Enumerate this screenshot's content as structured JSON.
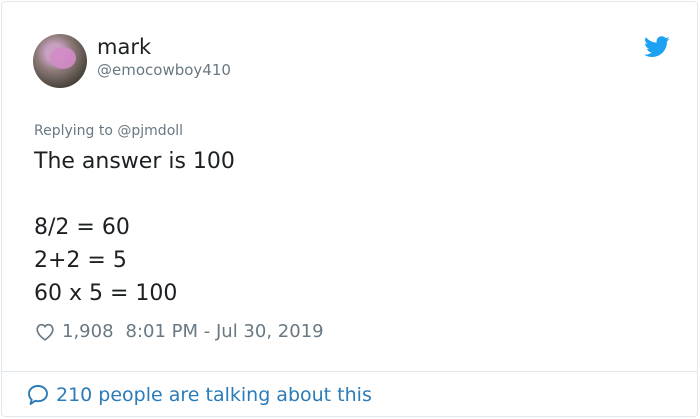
{
  "user": {
    "name": "mark",
    "handle": "@emocowboy410"
  },
  "reply": {
    "prefix": "Replying to ",
    "mention": "@pjmdoll"
  },
  "tweet": {
    "lines": [
      "The answer is 100",
      "",
      "8/2 = 60",
      "2+2 = 5",
      "60 x 5 = 100"
    ]
  },
  "meta": {
    "likes": "1,908",
    "timestamp": "8:01 PM - Jul 30, 2019"
  },
  "footer": {
    "talking": "210 people are talking about this"
  },
  "icons": {
    "bird": "twitter-bird-icon",
    "heart": "heart-icon",
    "bubble": "speech-bubble-icon"
  },
  "colors": {
    "twitter_blue": "#1da1f2",
    "link_blue": "#2b7bb9",
    "secondary_text": "#697882",
    "primary_text": "#1c2022",
    "border": "#e1e8ed"
  }
}
